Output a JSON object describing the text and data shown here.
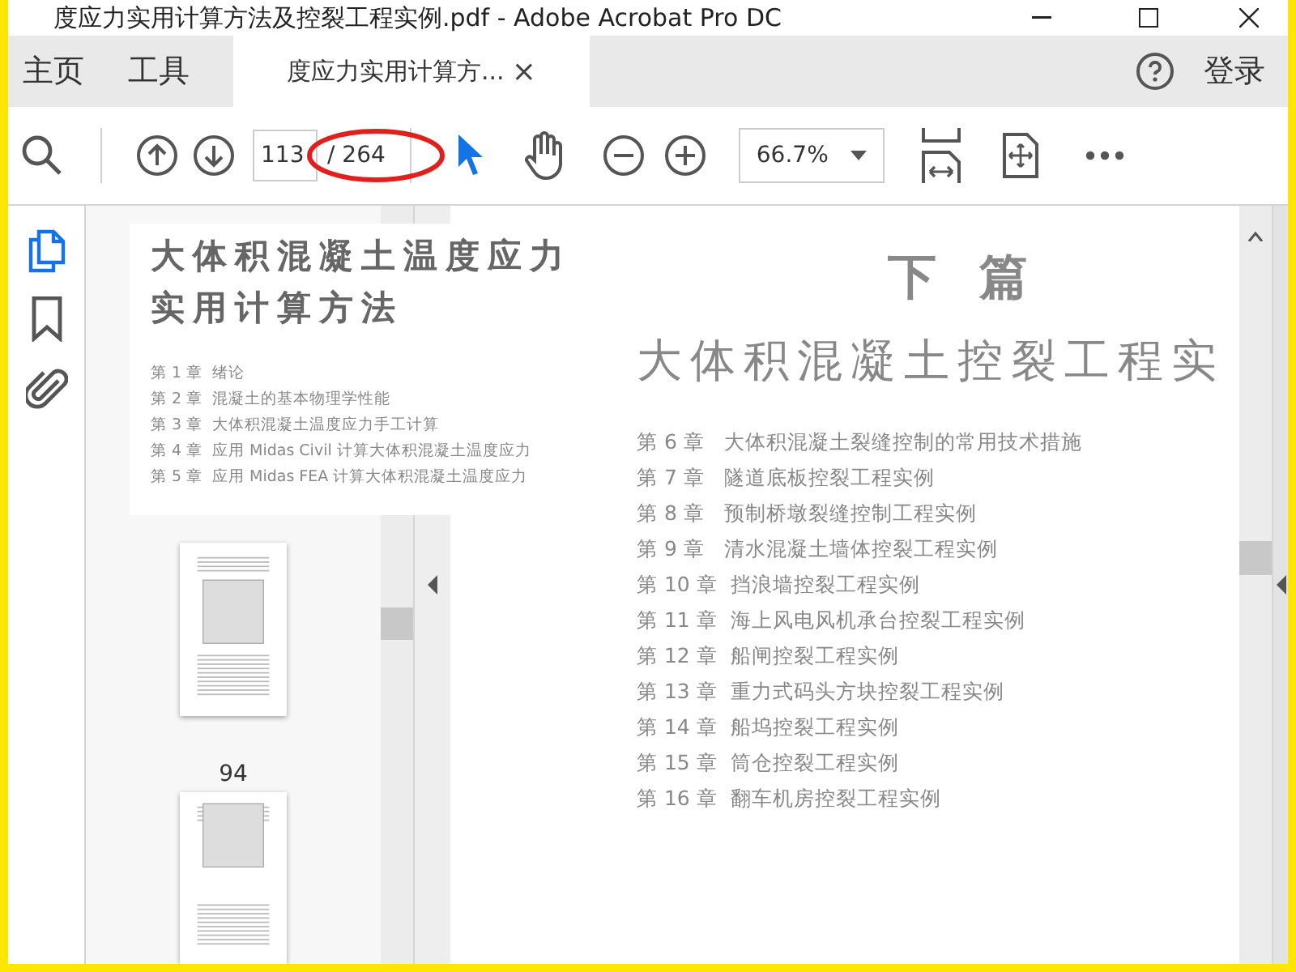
{
  "window": {
    "title": "度应力实用计算方法及控裂工程实例.pdf - Adobe Acrobat Pro DC"
  },
  "menu": [
    {
      "label": "主页"
    },
    {
      "label": "工具"
    }
  ],
  "tabs": [
    {
      "label": "度应力实用计算方...",
      "close": "×",
      "selected": true
    }
  ],
  "sign_in": "登录",
  "toolbar": {
    "page_number": "113",
    "page_total": "/ 264",
    "zoom": "66.7%"
  },
  "annotations": [
    {
      "kind": "ellipse"
    }
  ],
  "side_tools": [
    {
      "kind": "pages",
      "selected": true
    },
    {
      "kind": "bookmarks",
      "selected": false
    },
    {
      "kind": "attachments",
      "selected": false
    }
  ],
  "thumbnails": [
    {
      "label": "94"
    }
  ],
  "inset_page": {
    "title_lines": [
      "大体积混凝土温度应力",
      "实用计算方法"
    ],
    "chapters": [
      {
        "number": "第 1 章",
        "title": "绪论"
      },
      {
        "number": "第 2 章",
        "title": "混凝土的基本物理学性能"
      },
      {
        "number": "第 3 章",
        "title": "大体积混凝土温度应力手工计算"
      },
      {
        "number": "第 4 章",
        "title": "应用 Midas Civil 计算大体积混凝土温度应力"
      },
      {
        "number": "第 5 章",
        "title": "应用 Midas FEA 计算大体积混凝土温度应力"
      }
    ]
  },
  "document_page": {
    "part": "下 篇",
    "heading": "大体积混凝土控裂工程实",
    "chapters": [
      {
        "number": "第 6 章",
        "title": "大体积混凝土裂缝控制的常用技术措施"
      },
      {
        "number": "第 7 章",
        "title": "隧道底板控裂工程实例"
      },
      {
        "number": "第 8 章",
        "title": "预制桥墩裂缝控制工程实例"
      },
      {
        "number": "第 9 章",
        "title": "清水混凝土墙体控裂工程实例"
      },
      {
        "number": "第 10 章",
        "title": "挡浪墙控裂工程实例"
      },
      {
        "number": "第 11 章",
        "title": "海上风电风机承台控裂工程实例"
      },
      {
        "number": "第 12 章",
        "title": "船闸控裂工程实例"
      },
      {
        "number": "第 13 章",
        "title": "重力式码头方块控裂工程实例"
      },
      {
        "number": "第 14 章",
        "title": "船坞控裂工程实例"
      },
      {
        "number": "第 15 章",
        "title": "筒仓控裂工程实例"
      },
      {
        "number": "第 16 章",
        "title": "翻车机房控裂工程实例"
      }
    ]
  }
}
